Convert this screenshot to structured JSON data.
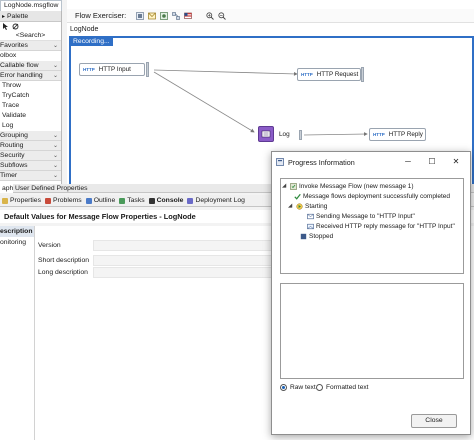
{
  "editor_tab": {
    "label": "LogNode.msgflow"
  },
  "palette": {
    "header": "Palette",
    "search": "<Search>",
    "items": [
      {
        "label": "Favorites",
        "kind": "drawer"
      },
      {
        "label": "olbox",
        "kind": "plain"
      },
      {
        "label": "Callable flow",
        "kind": "drawer"
      },
      {
        "label": "Error handling",
        "kind": "drawer"
      },
      {
        "label": "Throw",
        "kind": "item"
      },
      {
        "label": "TryCatch",
        "kind": "item"
      },
      {
        "label": "Trace",
        "kind": "item"
      },
      {
        "label": "Validate",
        "kind": "item"
      },
      {
        "label": "Log",
        "kind": "item"
      },
      {
        "label": "Grouping",
        "kind": "drawer"
      },
      {
        "label": "Routing",
        "kind": "drawer"
      },
      {
        "label": "Security",
        "kind": "drawer"
      },
      {
        "label": "Subflows",
        "kind": "drawer"
      },
      {
        "label": "Timer",
        "kind": "drawer"
      }
    ]
  },
  "flow": {
    "exerciser_label": "Flow Exerciser:",
    "breadcrumb": "LogNode",
    "recording_label": "Recording...",
    "nodes": {
      "http_input": "HTTP Input",
      "http_request": "HTTP Request",
      "log": "Log",
      "http_reply": "HTTP Reply"
    },
    "http_badge": "HTTP"
  },
  "properties": {
    "tabs": [
      "aph",
      "User Defined Properties"
    ],
    "views": [
      {
        "label": "Properties",
        "icon": "properties-icon"
      },
      {
        "label": "Problems",
        "icon": "problems-icon"
      },
      {
        "label": "Outline",
        "icon": "outline-icon"
      },
      {
        "label": "Tasks",
        "icon": "tasks-icon"
      },
      {
        "label": "Console",
        "icon": "console-icon"
      },
      {
        "label": "Deployment Log",
        "icon": "deployment-log-icon"
      }
    ],
    "title": "Default Values for Message Flow Properties - LogNode",
    "side": [
      "escription",
      "onitoring"
    ],
    "rows": [
      "Version",
      "Short description",
      "Long description"
    ]
  },
  "dialog": {
    "title": "Progress Information",
    "tree": [
      {
        "label": "Invoke Message Flow (new message 1)",
        "icon": "invoke-icon"
      },
      {
        "label": "Message flows deployment successfully completed",
        "icon": "check-icon"
      },
      {
        "label": "Starting",
        "icon": "starting-icon"
      },
      {
        "label": "Sending Message to \"HTTP Input\"",
        "icon": "send-icon"
      },
      {
        "label": "Received HTTP reply message for \"HTTP Input\"",
        "icon": "receive-icon"
      },
      {
        "label": "Stopped",
        "icon": "stopped-icon"
      }
    ],
    "raw_text": "Raw text",
    "formatted_text": "Formatted text",
    "close": "Close"
  },
  "colors": {
    "accent": "#2f6fc6",
    "log_node": "#8b5cc8",
    "check": "#2e8b3e"
  }
}
